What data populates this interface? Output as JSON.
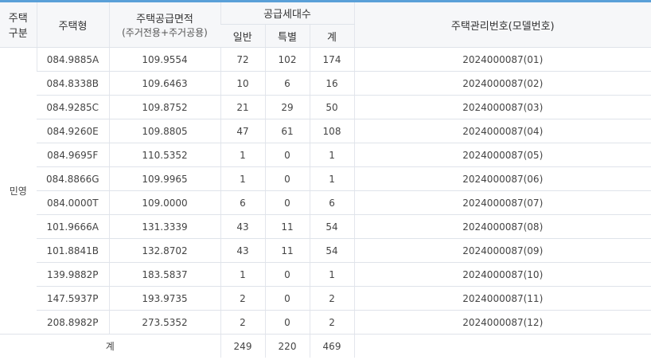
{
  "header": {
    "col_type_line1": "주택",
    "col_type_line2": "구분",
    "col_model": "주택형",
    "col_area_line1": "주택공급면적",
    "col_area_line2": "(주거전용+주거공용)",
    "col_units": "공급세대수",
    "col_general": "일반",
    "col_special": "특별",
    "col_sum": "계",
    "col_number": "주택관리번호(모델번호)"
  },
  "housing_type": "민영",
  "rows": [
    {
      "model": "084.9885A",
      "area": "109.9554",
      "general": "72",
      "special": "102",
      "sum": "174",
      "number": "2024000087(01)"
    },
    {
      "model": "084.8338B",
      "area": "109.6463",
      "general": "10",
      "special": "6",
      "sum": "16",
      "number": "2024000087(02)"
    },
    {
      "model": "084.9285C",
      "area": "109.8752",
      "general": "21",
      "special": "29",
      "sum": "50",
      "number": "2024000087(03)"
    },
    {
      "model": "084.9260E",
      "area": "109.8805",
      "general": "47",
      "special": "61",
      "sum": "108",
      "number": "2024000087(04)"
    },
    {
      "model": "084.9695F",
      "area": "110.5352",
      "general": "1",
      "special": "0",
      "sum": "1",
      "number": "2024000087(05)"
    },
    {
      "model": "084.8866G",
      "area": "109.9965",
      "general": "1",
      "special": "0",
      "sum": "1",
      "number": "2024000087(06)"
    },
    {
      "model": "084.0000T",
      "area": "109.0000",
      "general": "6",
      "special": "0",
      "sum": "6",
      "number": "2024000087(07)"
    },
    {
      "model": "101.9666A",
      "area": "131.3339",
      "general": "43",
      "special": "11",
      "sum": "54",
      "number": "2024000087(08)"
    },
    {
      "model": "101.8841B",
      "area": "132.8702",
      "general": "43",
      "special": "11",
      "sum": "54",
      "number": "2024000087(09)"
    },
    {
      "model": "139.9882P",
      "area": "183.5837",
      "general": "1",
      "special": "0",
      "sum": "1",
      "number": "2024000087(10)"
    },
    {
      "model": "147.5937P",
      "area": "193.9735",
      "general": "2",
      "special": "0",
      "sum": "2",
      "number": "2024000087(11)"
    },
    {
      "model": "208.8982P",
      "area": "273.5352",
      "general": "2",
      "special": "0",
      "sum": "2",
      "number": "2024000087(12)"
    }
  ],
  "total": {
    "label": "계",
    "general": "249",
    "special": "220",
    "sum": "469"
  },
  "colors": {
    "accent_line": "#5aa0d8",
    "header_bg": "#f6f7f9",
    "border": "#dfe3ea"
  }
}
